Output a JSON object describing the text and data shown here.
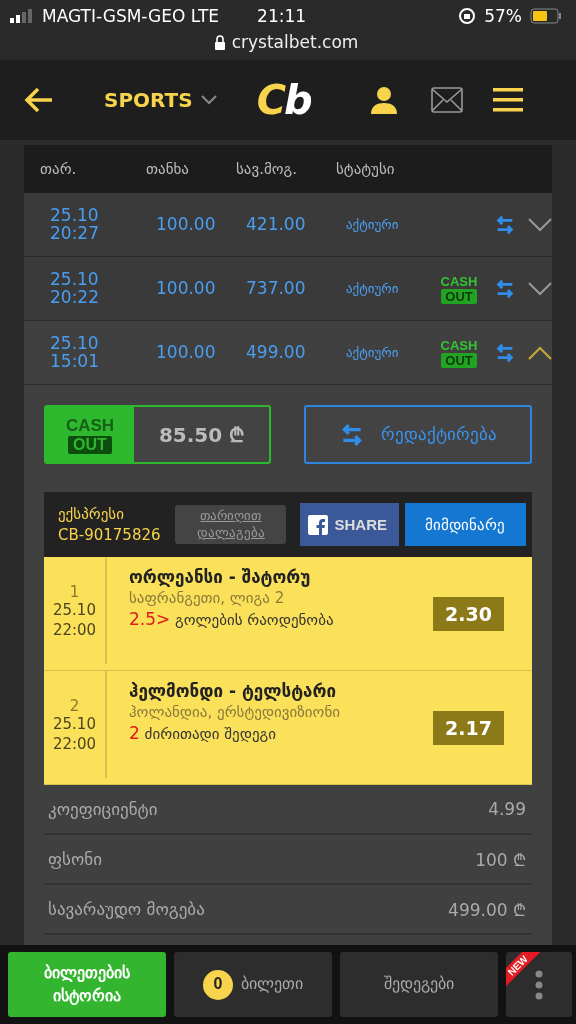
{
  "status_bar": {
    "carrier": "MAGTI-GSM-GEO LTE",
    "time": "21:11",
    "battery": "57%",
    "url": "crystalbet.com"
  },
  "header": {
    "section": "SPORTS",
    "logo": "Cb"
  },
  "table": {
    "columns": [
      "თარ.",
      "თანხა",
      "სავ.მოგ.",
      "სტატუსი"
    ],
    "rows": [
      {
        "date": "25.10",
        "time": "20:27",
        "stake": "100.00",
        "win": "421.00",
        "status": "აქტიური",
        "expanded": false
      },
      {
        "date": "25.10",
        "time": "20:22",
        "stake": "100.00",
        "win": "737.00",
        "status": "აქტიური",
        "cashout_badge": [
          "CASH",
          "OUT"
        ],
        "expanded": false
      },
      {
        "date": "25.10",
        "time": "15:01",
        "stake": "100.00",
        "win": "499.00",
        "status": "აქტიური",
        "cashout_badge": [
          "CASH",
          "OUT"
        ],
        "expanded": true
      }
    ]
  },
  "detail": {
    "cashout_button": {
      "label": [
        "CASH",
        "OUT"
      ],
      "amount": "85.50 ₾"
    },
    "edit_button": "რედაქტირება",
    "ticket": {
      "type": "ექსპრესი",
      "id": "CB-90175826",
      "sort_button": "თარიღით დალაგება",
      "share_button": "SHARE",
      "state_button": "მიმდინარე",
      "bets": [
        {
          "number": "1",
          "date": "25.10",
          "time": "22:00",
          "match": "ორლეანსი - შატორუ",
          "league": "საფრანგეთი, ლიგა 2",
          "pick": "2.5>",
          "market": "გოლების რაოდენობა",
          "odds": "2.30"
        },
        {
          "number": "2",
          "date": "25.10",
          "time": "22:00",
          "match": "ჰელმონდი - ტელსტარი",
          "league": "ჰოლანდია, ერსტედივიზიონი",
          "pick": "2",
          "market": "ძირითადი შედეგი",
          "odds": "2.17"
        }
      ]
    },
    "summary": [
      {
        "label": "კოეფიციენტი",
        "value": "4.99"
      },
      {
        "label": "ფსონი",
        "value": "100 ₾"
      },
      {
        "label": "სავარაუდო მოგება",
        "value": "499.00 ₾"
      }
    ]
  },
  "bottom_nav": [
    {
      "kind": "active",
      "label": "ბილეთების ისტორია",
      "selected": true
    },
    {
      "kind": "count",
      "count": "0",
      "label": "ბილეთი",
      "selected": false
    },
    {
      "kind": "plain",
      "label": "შედეგები",
      "selected": false
    },
    {
      "kind": "more",
      "badge": "NEW",
      "selected": false
    }
  ]
}
